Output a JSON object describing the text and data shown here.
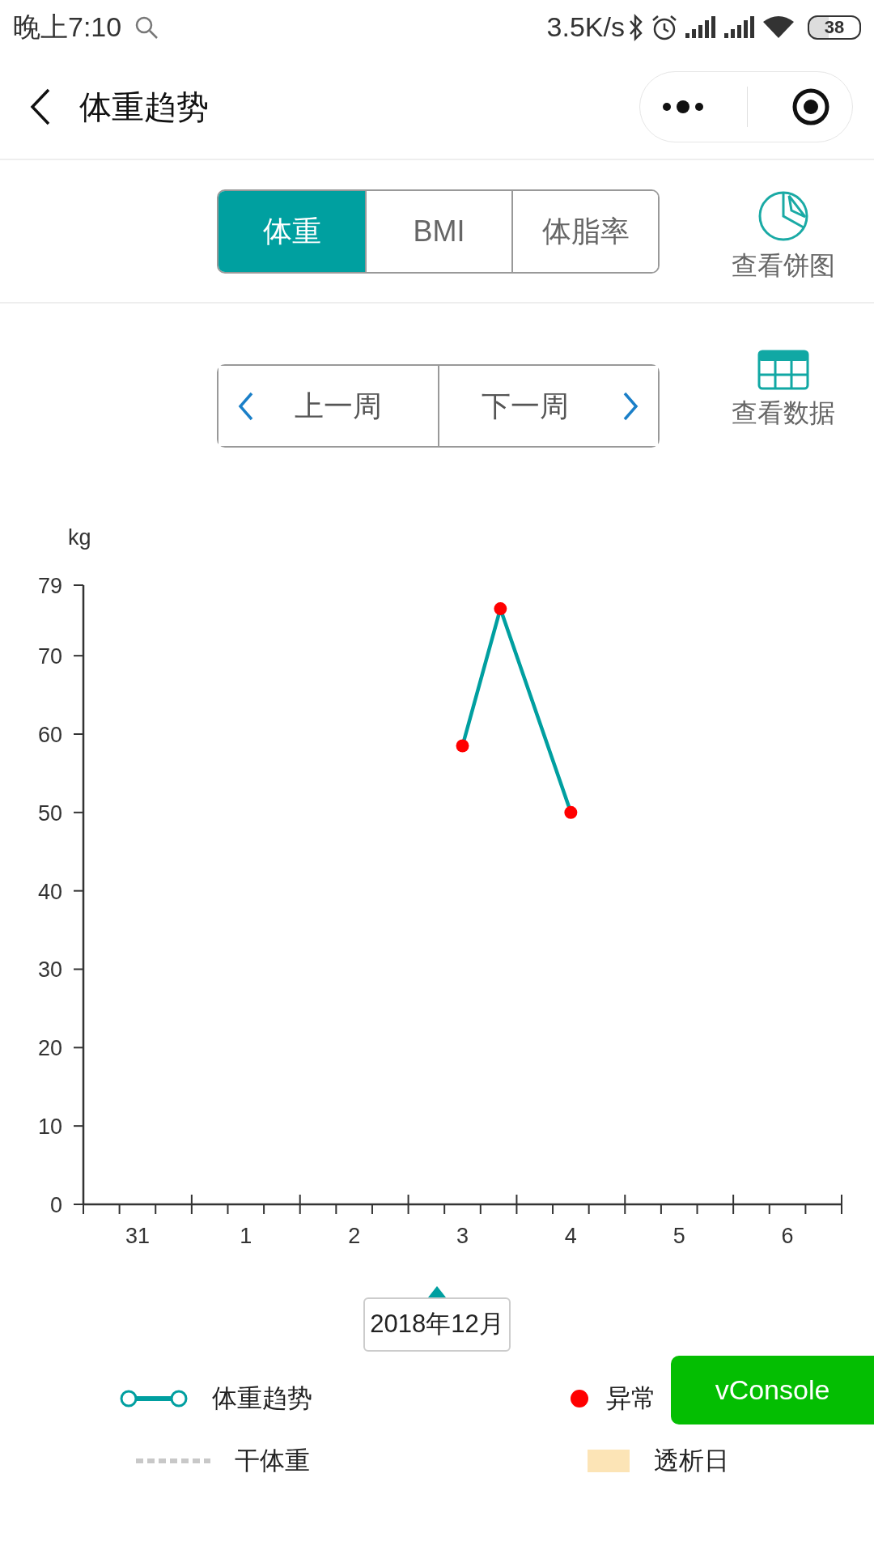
{
  "status_bar": {
    "time": "晚上7:10",
    "network_speed": "3.5K/s",
    "battery": "38"
  },
  "header": {
    "title": "体重趋势"
  },
  "tabs": [
    {
      "label": "体重",
      "selected": true
    },
    {
      "label": "BMI",
      "selected": false
    },
    {
      "label": "体脂率",
      "selected": false
    }
  ],
  "pie_link": {
    "label": "查看饼图"
  },
  "week_nav": {
    "previous": "上一周",
    "next": "下一周"
  },
  "data_link": {
    "label": "查看数据"
  },
  "chart": {
    "chart_data": {
      "type": "line",
      "ylabel": "kg",
      "x": [
        "2019-01-03T12:00",
        "2019-01-03T20:24",
        "2019-01-04T12:00"
      ],
      "series": [
        {
          "name": "体重趋势",
          "color": "#009fa0",
          "marker": "circle",
          "values": [
            58.5,
            76,
            50
          ]
        }
      ],
      "xlim": [
        "2018-12-31T00:00",
        "2019-01-07T00:00"
      ],
      "ylim": [
        0,
        79
      ],
      "xticks": [
        {
          "value": "2018-12-31T12:00",
          "label": "31"
        },
        {
          "value": "2019-01-01T12:00",
          "label": "1"
        },
        {
          "value": "2019-01-02T12:00",
          "label": "2"
        },
        {
          "value": "2019-01-03T12:00",
          "label": "3"
        },
        {
          "value": "2019-01-04T12:00",
          "label": "4"
        },
        {
          "value": "2019-01-05T12:00",
          "label": "5"
        },
        {
          "value": "2019-01-06T12:00",
          "label": "6"
        }
      ],
      "yticks": [
        0,
        10,
        20,
        30,
        40,
        50,
        60,
        70,
        79
      ]
    }
  },
  "month_label": "2018年12月",
  "legend": [
    {
      "kind": "series"
    },
    {
      "label": "异常",
      "kind": "dot",
      "color": "#ff0000"
    },
    {
      "label": "干体重",
      "kind": "dashed",
      "color": "#c8c8c8"
    },
    {
      "label": "透析日",
      "kind": "swatch",
      "color": "#fce4b6"
    }
  ],
  "vconsole": {
    "label": "vConsole"
  }
}
